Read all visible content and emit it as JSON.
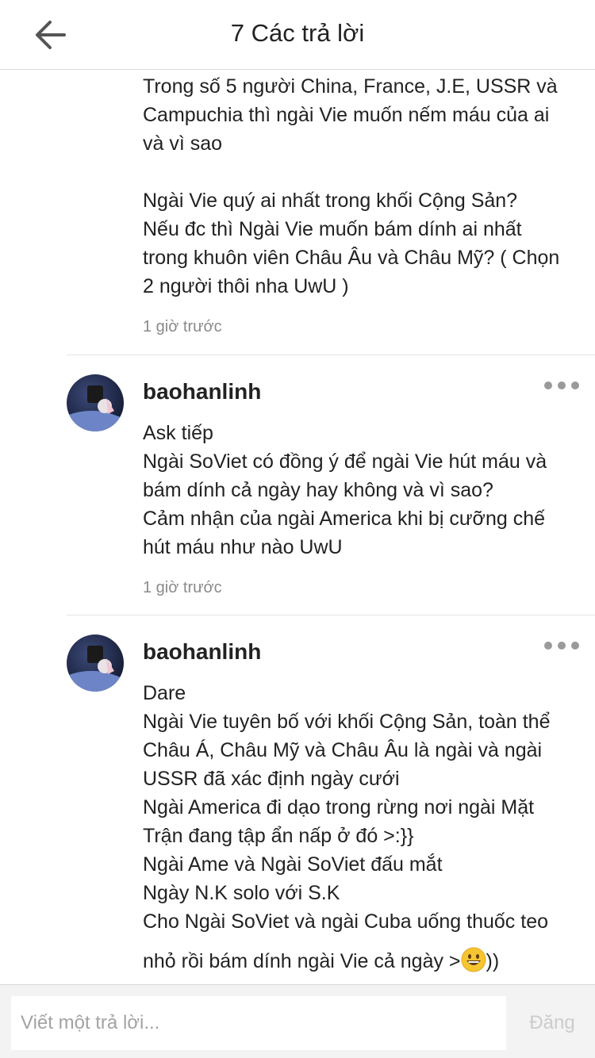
{
  "header": {
    "title": "7 Các trả lời",
    "back_icon": "arrow-left-icon"
  },
  "comments": [
    {
      "username": "",
      "text": "Trong số 5 người China, France, J.E, USSR và\nCampuchia thì ngài Vie muốn nếm máu của ai\nvà vì sao\n\nNgài Vie quý ai nhất trong khối Cộng Sản?\nNếu đc thì Ngài Vie muốn bám dính ai nhất\ntrong khuôn viên Châu Âu và Châu Mỹ? ( Chọn\n2 người thôi nha UwU )",
      "time": "1 giờ trước"
    },
    {
      "username": "baohanlinh",
      "text": "Ask tiếp\nNgài SoViet có đồng ý để ngài Vie hút máu và\nbám dính cả ngày hay không và vì sao?\nCảm nhận của ngài America khi bị cưỡng chế\nhút máu như nào UwU",
      "time": "1 giờ trước"
    },
    {
      "username": "baohanlinh",
      "text": "Dare\nNgài Vie tuyên bố với khối Cộng Sản, toàn thể\nChâu Á, Châu Mỹ và Châu Âu là ngài và ngài\nUSSR đã xác định ngày cưới\nNgài America đi dạo trong rừng nơi ngài Mặt\nTrận đang tập ẩn nấp ở đó >:}}\nNgài Ame và Ngài SoViet đấu mắt\nNgày N.K solo với S.K\nCho Ngài SoViet và ngài Cuba uống thuốc teo",
      "last_line_before": "nhỏ rồi bám dính ngài Vie cả ngày >",
      "last_line_after": "))",
      "emoji": "grinning-face-emoji"
    }
  ],
  "footer": {
    "placeholder": "Viết một trả lời...",
    "post_label": "Đăng"
  },
  "colors": {
    "text": "#222222",
    "muted": "#8a8a8a",
    "divider": "#e2e2e2",
    "post_disabled": "#cccccc",
    "footer_bg": "#f3f3f3"
  }
}
